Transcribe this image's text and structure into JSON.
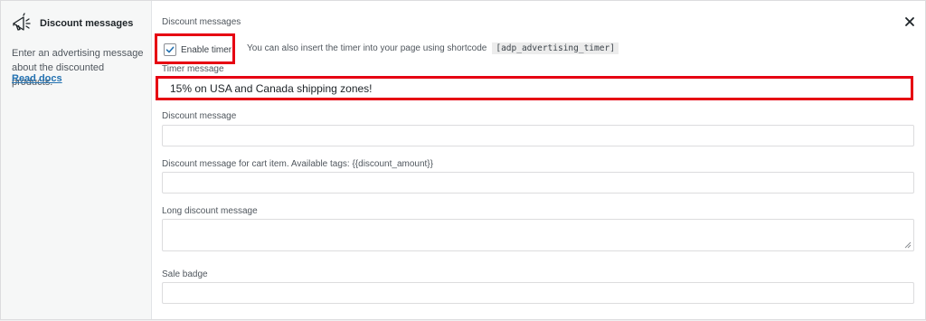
{
  "sidebar": {
    "title": "Discount messages",
    "description": "Enter an advertising message about the discounted products.",
    "link": "Read docs",
    "icon": "megaphone-icon"
  },
  "section": {
    "title": "Discount messages",
    "close_icon": "close-icon"
  },
  "timer": {
    "checked": true,
    "label": "Enable timer",
    "hint": "You can also insert the timer into your page using shortcode",
    "shortcode": "[adp_advertising_timer]"
  },
  "fields": {
    "timer_message": {
      "label": "Timer message",
      "value": "15% on USA and Canada shipping zones!"
    },
    "discount_message": {
      "label": "Discount message",
      "value": ""
    },
    "cart_item_message": {
      "label": "Discount message for cart item. Available tags: {{discount_amount}}",
      "value": ""
    },
    "long_message": {
      "label": "Long discount message",
      "value": ""
    },
    "sale_badge": {
      "label": "Sale badge",
      "value": ""
    }
  },
  "colors": {
    "highlight": "#e60012",
    "link": "#2271b1",
    "checkbox_check": "#2271b1"
  }
}
